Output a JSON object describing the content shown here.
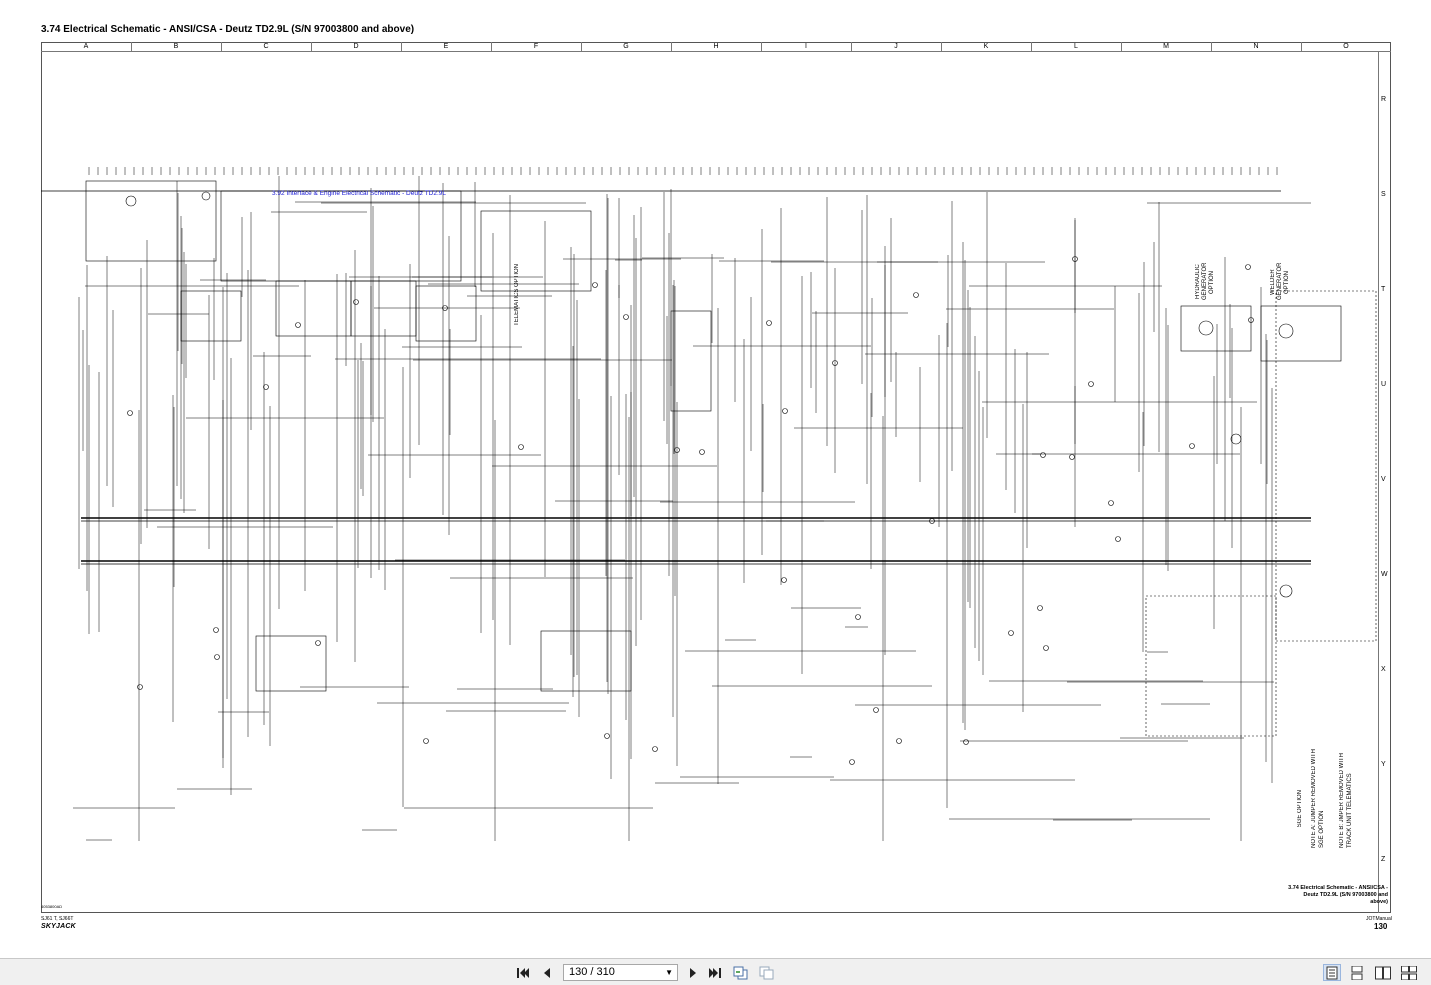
{
  "document": {
    "title": "3.74 Electrical Schematic - ANSI/CSA - Deutz TD2.9L (S/N 97003800 and above)",
    "subsection_ref": "3.92 Interface & Engine Electrical Schematic - Deutz TD2.9L",
    "columns": [
      "A",
      "B",
      "C",
      "D",
      "E",
      "F",
      "G",
      "H",
      "I",
      "J",
      "K",
      "L",
      "M",
      "N",
      "O"
    ],
    "rows": [
      "R",
      "S",
      "T",
      "U",
      "V",
      "W",
      "X",
      "Y",
      "Z"
    ],
    "telematics_label": "TELEMATICS OPTION",
    "hydraulic_generator_label": "HYDRAULIC GENERATOR OPTION",
    "welder_generator_label": "WELDER GENERATOR OPTION",
    "sge_option_label": "SGE OPTION",
    "note_a": "NOTE A: JUMPER REMOVED WITH SGE OPTION",
    "note_b": "NOTE B: JMPER REMOVED WITH TRACK UNIT TELEMATICS",
    "footer_caption_line1": "3.74  Electrical Schematic - ANSI/CSA -",
    "footer_caption_line2": "Deutz TD2.9L (S/N 97003800 and",
    "footer_caption_line3": "above)",
    "model_line": "SJ61 T, SJ66T",
    "logo": "SKYJACK",
    "doc_number": "4053800AD",
    "manual_label": "JOTManual",
    "page_number": "130"
  },
  "viewer": {
    "page_indicator": "130 / 310",
    "buttons": {
      "first_page": "first-page",
      "prev_page": "previous-page",
      "next_page": "next-page",
      "last_page": "last-page",
      "go_back": "go-back",
      "go_forward": "go-forward"
    },
    "view_modes": [
      "single-page",
      "continuous",
      "two-page",
      "two-page-continuous"
    ]
  },
  "colors": {
    "wire": "#000000",
    "reference_text": "#1b1bd6",
    "toolbar_bg": "#f0f0f0",
    "active_view": "#d8e4f4"
  }
}
